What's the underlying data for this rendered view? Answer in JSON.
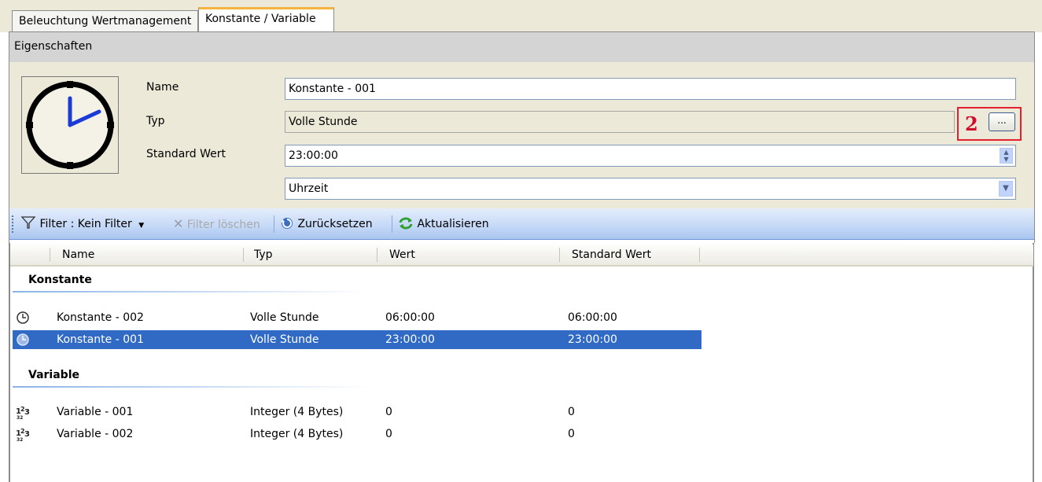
{
  "tabs": [
    {
      "label": "Beleuchtung Wertmanagement",
      "active": false
    },
    {
      "label": "Konstante / Variable",
      "active": true
    }
  ],
  "properties": {
    "header": "Eigenschaften",
    "name_label": "Name",
    "name_value": "Konstante - 001",
    "typ_label": "Typ",
    "typ_value": "Volle Stunde",
    "browse_label": "...",
    "standard_label": "Standard Wert",
    "standard_value": "23:00:00",
    "format_value": "Uhrzeit",
    "icon": "clock-icon"
  },
  "annotation": {
    "number": "2",
    "color": "#e5202e"
  },
  "toolbar": {
    "filter_label": "Filter : Kein Filter",
    "clear_filter_label": "Filter löschen",
    "reset_label": "Zurücksetzen",
    "refresh_label": "Aktualisieren"
  },
  "grid": {
    "columns": [
      "Name",
      "Typ",
      "Wert",
      "Standard Wert"
    ],
    "groups": [
      {
        "title": "Konstante",
        "rows": [
          {
            "name": "Konstante - 002",
            "typ": "Volle Stunde",
            "wert": "06:00:00",
            "standard": "06:00:00",
            "icon": "clock-icon",
            "selected": false
          },
          {
            "name": "Konstante - 001",
            "typ": "Volle Stunde",
            "wert": "23:00:00",
            "standard": "23:00:00",
            "icon": "clock-icon",
            "selected": true
          }
        ]
      },
      {
        "title": "Variable",
        "rows": [
          {
            "name": "Variable - 001",
            "typ": "Integer (4 Bytes)",
            "wert": "0",
            "standard": "0",
            "icon": "integer-icon",
            "selected": false
          },
          {
            "name": "Variable - 002",
            "typ": "Integer (4 Bytes)",
            "wert": "0",
            "standard": "0",
            "icon": "integer-icon",
            "selected": false
          }
        ]
      }
    ]
  },
  "colors": {
    "selection": "#316ac5",
    "tab_accent": "#f3b33d",
    "toolbar": "#c4d8f7"
  }
}
